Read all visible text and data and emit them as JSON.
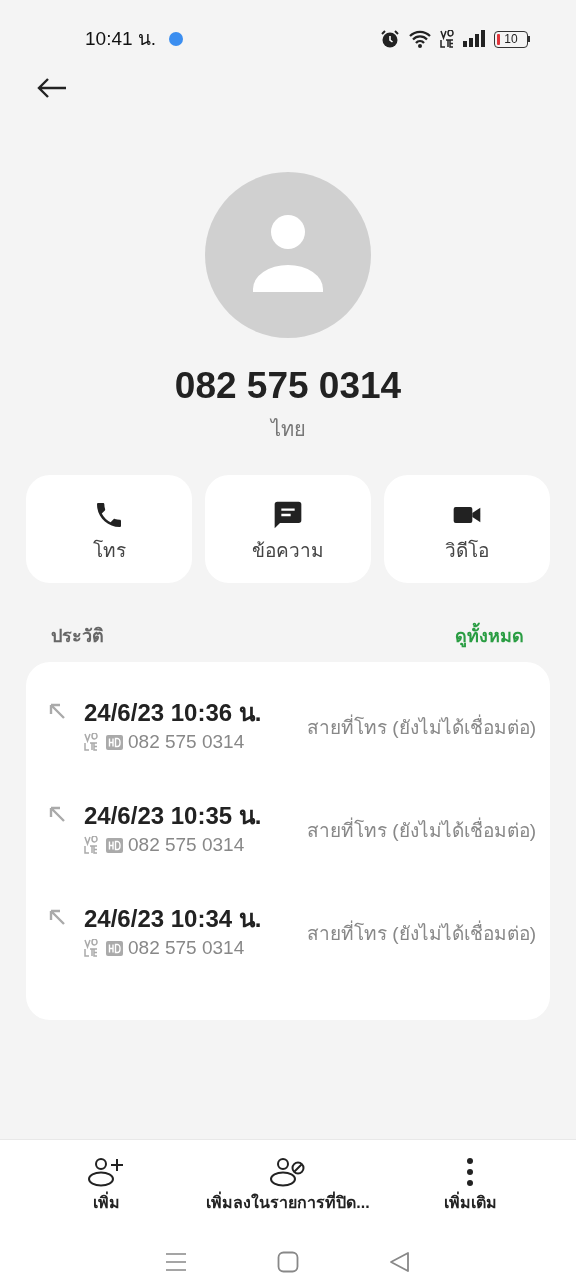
{
  "status_bar": {
    "time": "10:41 น.",
    "battery": "10"
  },
  "contact": {
    "number": "082 575 0314",
    "location": "ไทย"
  },
  "actions": [
    {
      "kind": "call",
      "label": "โทร"
    },
    {
      "kind": "message",
      "label": "ข้อความ"
    },
    {
      "kind": "video",
      "label": "วิดีโอ"
    }
  ],
  "history": {
    "title": "ประวัติ",
    "see_all": "ดูทั้งหมด",
    "calls": [
      {
        "time": "24/6/23 10:36 น.",
        "number": "082 575 0314",
        "status": "สายที่โทร (ยังไม่ได้เชื่อมต่อ)"
      },
      {
        "time": "24/6/23 10:35 น.",
        "number": "082 575 0314",
        "status": "สายที่โทร (ยังไม่ได้เชื่อมต่อ)"
      },
      {
        "time": "24/6/23 10:34 น.",
        "number": "082 575 0314",
        "status": "สายที่โทร (ยังไม่ได้เชื่อมต่อ)"
      }
    ]
  },
  "bottom_bar": [
    {
      "kind": "add",
      "label": "เพิ่ม"
    },
    {
      "kind": "block",
      "label": "เพิ่มลงในรายการที่ปิด..."
    },
    {
      "kind": "more",
      "label": "เพิ่มเติม"
    }
  ]
}
